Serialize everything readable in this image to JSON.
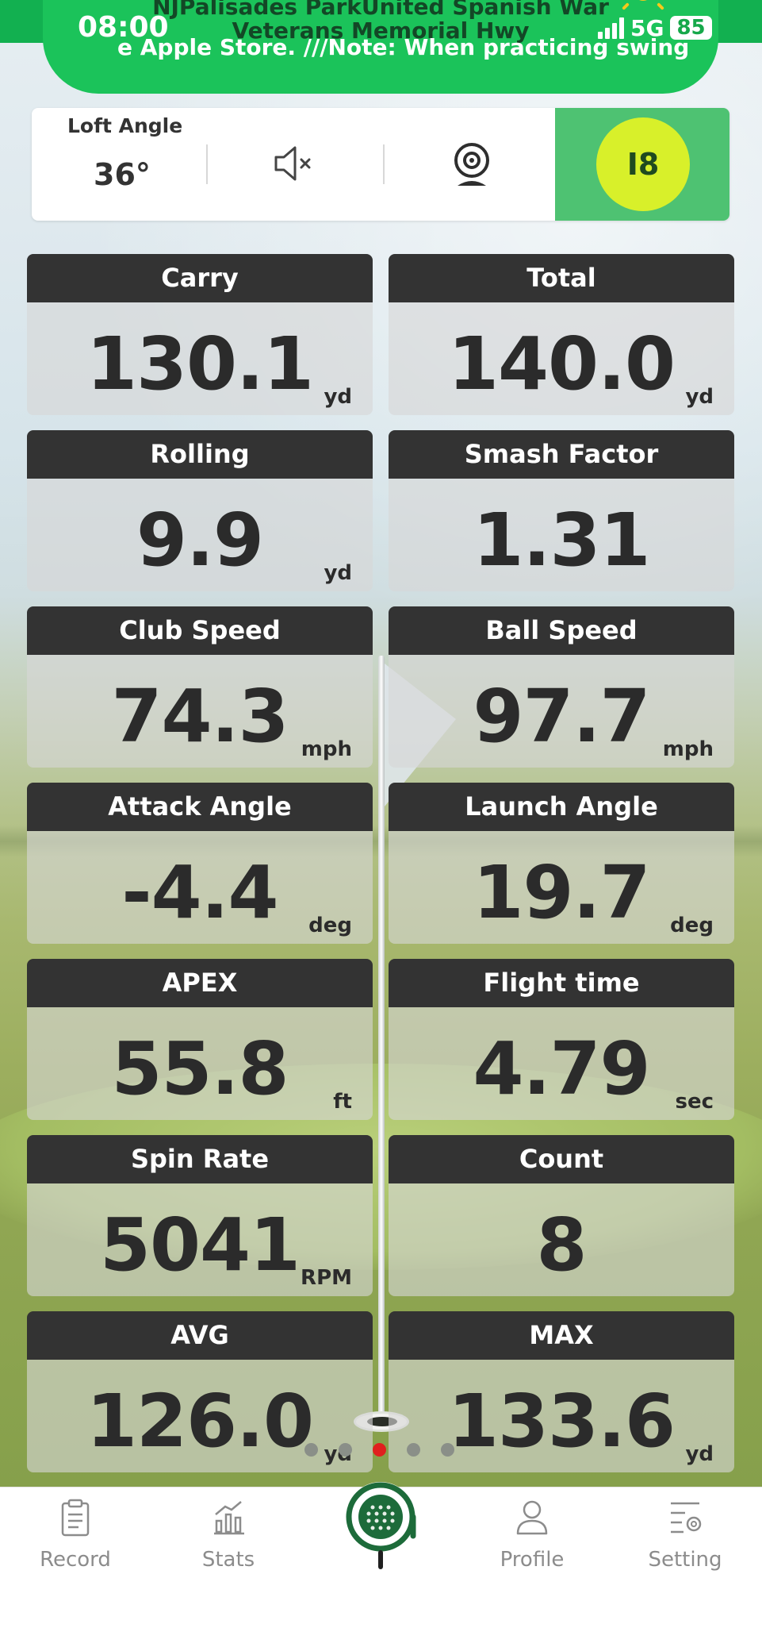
{
  "status_bar": {
    "address_line1": "NJPalisades ParkUnited Spanish War",
    "address_line2": "Veterans Memorial Hwy",
    "ticker": "e Apple Store.  ///Note: When practicing swings,",
    "time": "08:00",
    "network": "5G",
    "battery": "85"
  },
  "settings": {
    "loft_label": "Loft Angle",
    "loft_value": "36°",
    "club": "I8"
  },
  "metrics": [
    {
      "label": "Carry",
      "value": "130.1",
      "unit": "yd"
    },
    {
      "label": "Total",
      "value": "140.0",
      "unit": "yd"
    },
    {
      "label": "Rolling",
      "value": "9.9",
      "unit": "yd"
    },
    {
      "label": "Smash Factor",
      "value": "1.31",
      "unit": ""
    },
    {
      "label": "Club Speed",
      "value": "74.3",
      "unit": "mph"
    },
    {
      "label": "Ball Speed",
      "value": "97.7",
      "unit": "mph"
    },
    {
      "label": "Attack Angle",
      "value": "-4.4",
      "unit": "deg"
    },
    {
      "label": "Launch Angle",
      "value": "19.7",
      "unit": "deg"
    },
    {
      "label": "APEX",
      "value": "55.8",
      "unit": "ft"
    },
    {
      "label": "Flight time",
      "value": "4.79",
      "unit": "sec"
    },
    {
      "label": "Spin Rate",
      "value": "5041",
      "unit": "RPM"
    },
    {
      "label": "Count",
      "value": "8",
      "unit": ""
    },
    {
      "label": "AVG",
      "value": "126.0",
      "unit": "yd"
    },
    {
      "label": "MAX",
      "value": "133.6",
      "unit": "yd"
    }
  ],
  "pager": {
    "pages": 5,
    "active": 2
  },
  "nav": {
    "record": "Record",
    "stats": "Stats",
    "profile": "Profile",
    "setting": "Setting"
  },
  "colors": {
    "accent_green": "#1bc35a",
    "club_panel": "#4ec272",
    "club_button": "#d8f02a",
    "card_header": "#333333",
    "active_dot": "#e0201e"
  }
}
